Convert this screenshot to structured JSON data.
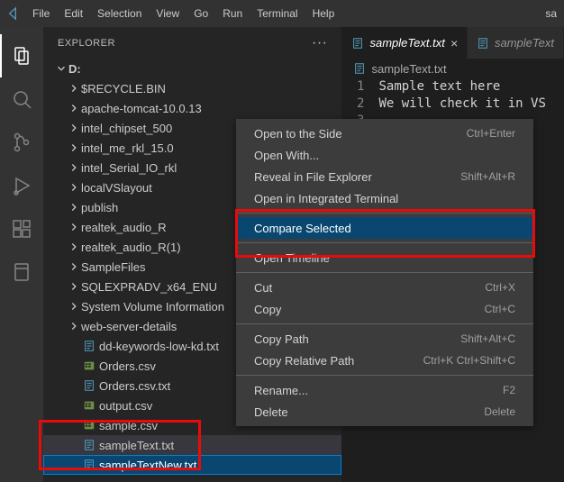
{
  "menubar": {
    "items": [
      "File",
      "Edit",
      "Selection",
      "View",
      "Go",
      "Run",
      "Terminal",
      "Help"
    ],
    "rightLabel": "sa"
  },
  "activityBar": {
    "items": [
      "files-icon",
      "search-icon",
      "source-control-icon",
      "run-debug-icon",
      "extensions-icon",
      "notebook-icon"
    ]
  },
  "sidebar": {
    "title": "EXPLORER",
    "rootLabel": "D:",
    "items": [
      {
        "kind": "folder",
        "label": "$RECYCLE.BIN"
      },
      {
        "kind": "folder",
        "label": "apache-tomcat-10.0.13"
      },
      {
        "kind": "folder",
        "label": "intel_chipset_500"
      },
      {
        "kind": "folder",
        "label": "intel_me_rkl_15.0"
      },
      {
        "kind": "folder",
        "label": "intel_Serial_IO_rkl"
      },
      {
        "kind": "folder",
        "label": "localVSlayout"
      },
      {
        "kind": "folder",
        "label": "publish"
      },
      {
        "kind": "folder",
        "label": "realtek_audio_R"
      },
      {
        "kind": "folder",
        "label": "realtek_audio_R(1)"
      },
      {
        "kind": "folder",
        "label": "SampleFiles"
      },
      {
        "kind": "folder",
        "label": "SQLEXPRADV_x64_ENU"
      },
      {
        "kind": "folder",
        "label": "System Volume Information"
      },
      {
        "kind": "folder",
        "label": "web-server-details"
      },
      {
        "kind": "txt",
        "label": "dd-keywords-low-kd.txt"
      },
      {
        "kind": "csv",
        "label": "Orders.csv"
      },
      {
        "kind": "txt",
        "label": "Orders.csv.txt"
      },
      {
        "kind": "csv",
        "label": "output.csv"
      },
      {
        "kind": "csv",
        "label": "sample.csv"
      },
      {
        "kind": "txt",
        "label": "sampleText.txt",
        "sel": "inactive"
      },
      {
        "kind": "txt",
        "label": "sampleTextNew.txt",
        "sel": "active"
      }
    ]
  },
  "tabs": {
    "items": [
      {
        "label": "sampleText.txt",
        "active": true
      },
      {
        "label": "sampleText",
        "active": false
      }
    ],
    "breadcrumb": "sampleText.txt"
  },
  "editor": {
    "lineNumbers": [
      "1",
      "2",
      "3"
    ],
    "lines": [
      "Sample text here",
      "We will check it in VS",
      ""
    ]
  },
  "contextMenu": {
    "sections": [
      [
        {
          "label": "Open to the Side",
          "shortcut": "Ctrl+Enter"
        },
        {
          "label": "Open With..."
        },
        {
          "label": "Reveal in File Explorer",
          "shortcut": "Shift+Alt+R"
        },
        {
          "label": "Open in Integrated Terminal"
        }
      ],
      [
        {
          "label": "Compare Selected",
          "hover": true
        }
      ],
      [
        {
          "label": "Open Timeline"
        }
      ],
      [
        {
          "label": "Cut",
          "shortcut": "Ctrl+X"
        },
        {
          "label": "Copy",
          "shortcut": "Ctrl+C"
        }
      ],
      [
        {
          "label": "Copy Path",
          "shortcut": "Shift+Alt+C"
        },
        {
          "label": "Copy Relative Path",
          "shortcut": "Ctrl+K Ctrl+Shift+C"
        }
      ],
      [
        {
          "label": "Rename...",
          "shortcut": "F2"
        },
        {
          "label": "Delete",
          "shortcut": "Delete"
        }
      ]
    ]
  },
  "accent": "#007ACC"
}
